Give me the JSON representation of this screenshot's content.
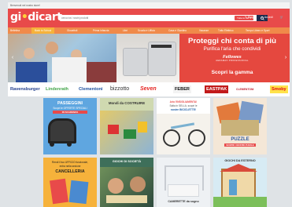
{
  "top_strip": "Benvenuti nel nostro store!",
  "logo": {
    "text_a": "gi",
    "text_b": "•",
    "text_c": "dicart"
  },
  "search": {
    "placeholder": "cerca tra i nostri prodotti",
    "category": "Tutte le cat. ▾",
    "button_icon": "search-icon"
  },
  "header_links": {
    "blog": "✎ Blog",
    "account": "☺ Accedi",
    "cart": "🛒"
  },
  "nav": [
    "Bellelina",
    "Back to School",
    "Giocattoli",
    "Prima Infanzia",
    "Libri",
    "Scuola e Ufficio",
    "Casa e Giardino",
    "Vacanze",
    "Tutto Elettrico",
    "Tempo Libero e Sport"
  ],
  "hero": {
    "title": "Proteggi chi conta di più",
    "subtitle": "Purifica l'aria che condividi",
    "brand": "Fellowes",
    "brand_sub": "AERAMAX PROFESSIONAL",
    "cta": "Scopri la gamma",
    "prev": "‹",
    "next": "›"
  },
  "brands": [
    "Ravensburger",
    "Lindenrath",
    "Clementoni",
    "bizzotto",
    "Seven",
    "FEBER",
    "EASTPAK",
    "CLEMENTONI",
    "Smoby"
  ],
  "tiles": {
    "passeggini": {
      "title": "PASSEGGINI",
      "sub": "Scopri le OFFERTE SPECIALI",
      "badge": "IN SCADENZA"
    },
    "costruire": {
      "title": "Mondi da COSTRUIRE"
    },
    "bici": {
      "line1": "Aria l'INSIGLIAMENTA!",
      "line2": "Salta in SELLA, scopri le",
      "line3": "nostre BICICLETTE!"
    },
    "puzzle": {
      "title": "PUZZLE",
      "sub": "SCOPRI I NOSTRI PUZZLE"
    },
    "cancelleria": {
      "line1": "Rendi il tuo UFFICIO funzionale,",
      "line2": "entra nella sezione",
      "title": "CANCELLERIA"
    },
    "societa": {
      "title": "GIOCHI DI SOCIETÀ"
    },
    "camerette": {
      "title": "CAMERETTE da sogno"
    },
    "esterno": {
      "title": "GIOCHI DA ESTERNO"
    }
  }
}
